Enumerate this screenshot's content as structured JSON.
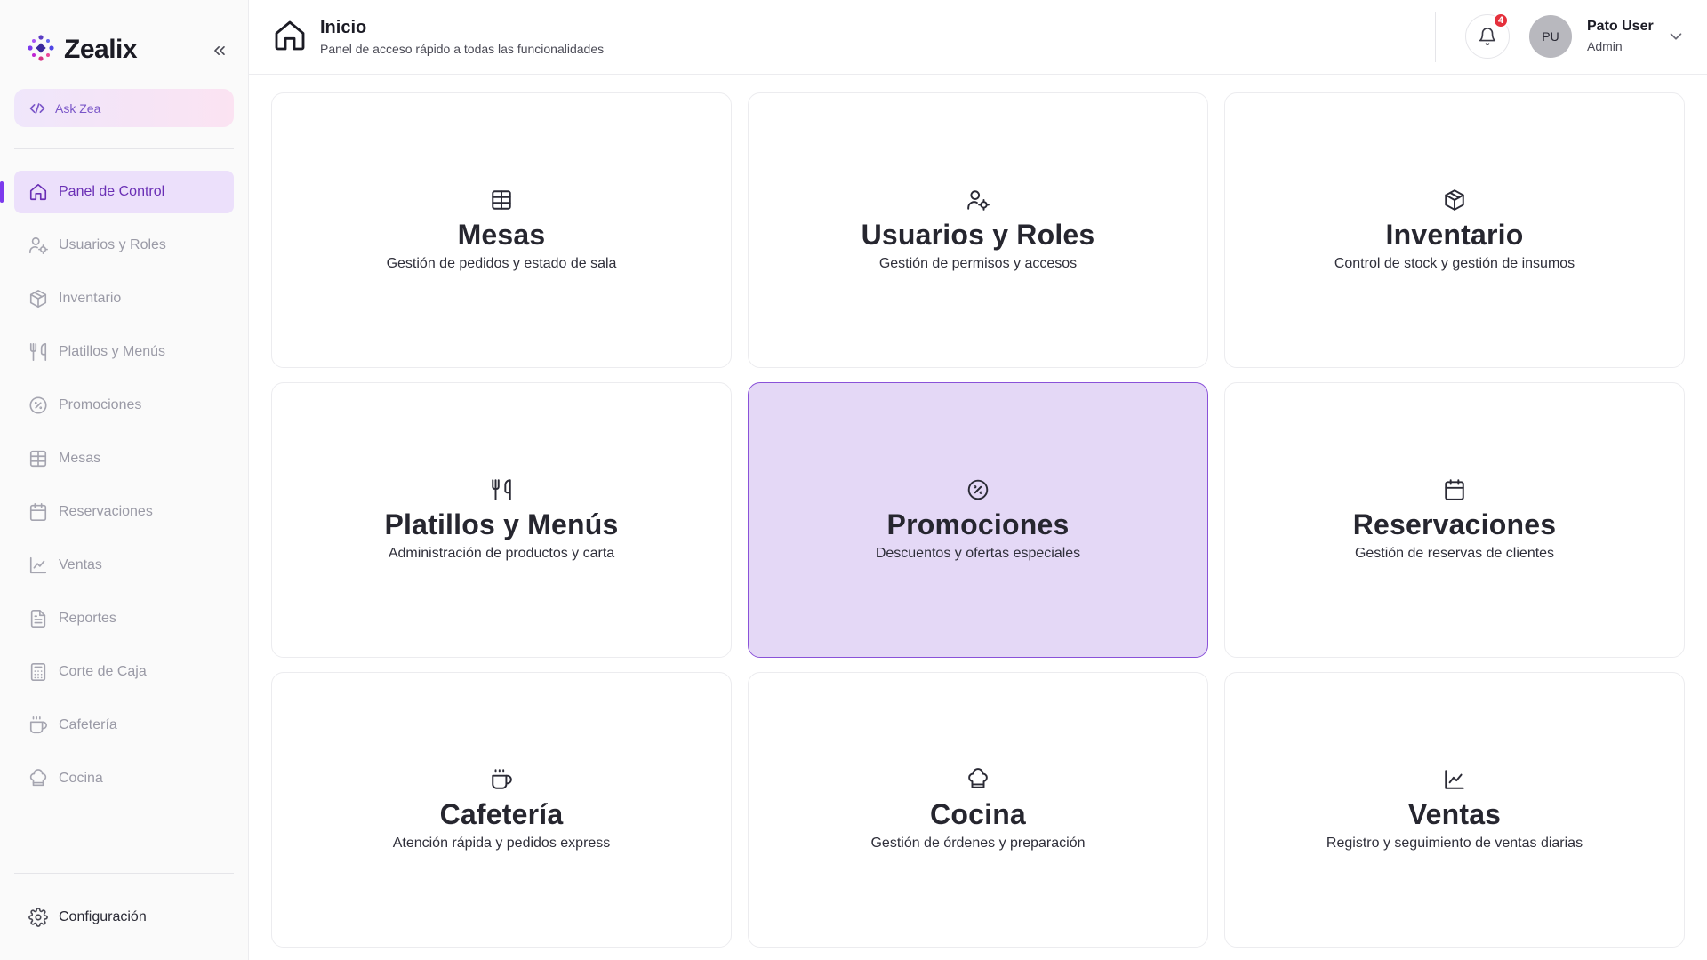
{
  "brand": {
    "name": "Zealix"
  },
  "ask": {
    "label": "Ask Zea"
  },
  "sidebar": {
    "items": [
      {
        "label": "Panel de Control"
      },
      {
        "label": "Usuarios y Roles"
      },
      {
        "label": "Inventario"
      },
      {
        "label": "Platillos y Menús"
      },
      {
        "label": "Promociones"
      },
      {
        "label": "Mesas"
      },
      {
        "label": "Reservaciones"
      },
      {
        "label": "Ventas"
      },
      {
        "label": "Reportes"
      },
      {
        "label": "Corte de Caja"
      },
      {
        "label": "Cafetería"
      },
      {
        "label": "Cocina"
      }
    ],
    "config_label": "Configuración"
  },
  "header": {
    "title": "Inicio",
    "subtitle": "Panel de acceso rápido a todas las funcionalidades",
    "notifications": "4",
    "user": {
      "initials": "PU",
      "name": "Pato User",
      "role": "Admin"
    }
  },
  "cards": [
    {
      "title": "Mesas",
      "desc": "Gestión de pedidos y estado de sala"
    },
    {
      "title": "Usuarios y Roles",
      "desc": "Gestión de permisos y accesos"
    },
    {
      "title": "Inventario",
      "desc": "Control de stock y gestión de insumos"
    },
    {
      "title": "Platillos y Menús",
      "desc": "Administración de productos y carta"
    },
    {
      "title": "Promociones",
      "desc": "Descuentos y ofertas especiales"
    },
    {
      "title": "Reservaciones",
      "desc": "Gestión de reservas de clientes"
    },
    {
      "title": "Cafetería",
      "desc": "Atención rápida y pedidos express"
    },
    {
      "title": "Cocina",
      "desc": "Gestión de órdenes y preparación"
    },
    {
      "title": "Ventas",
      "desc": "Registro y seguimiento de ventas diarias"
    }
  ],
  "colors": {
    "accent": "#7c3aed",
    "active_bg": "#ece0fb",
    "selected_card_bg": "#e4d8f6",
    "badge": "#e5303c"
  }
}
